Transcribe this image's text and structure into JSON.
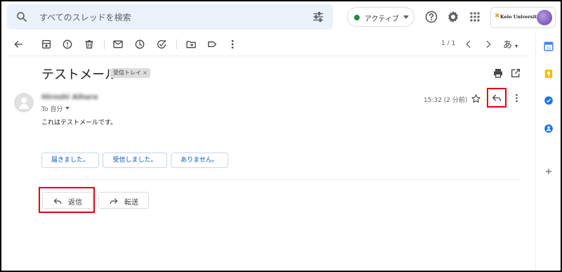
{
  "search": {
    "placeholder": "すべてのスレッドを検索"
  },
  "status": {
    "label": "アクティブ"
  },
  "org": {
    "mark": "✖",
    "name": "Keio University"
  },
  "pager": {
    "text": "1 / 1"
  },
  "input_tool": {
    "label": "あ"
  },
  "message": {
    "subject": "テストメール",
    "label_chip": "受信トレイ",
    "label_remove": "×",
    "sender": "Hiroshi Aihara",
    "to": "To 自分",
    "time": "15:32 (2 分前)",
    "body": "これはテストメールです。"
  },
  "smart_replies": [
    "届きました。",
    "受信しました。",
    "ありません。"
  ],
  "actions": {
    "reply": "返信",
    "forward": "転送"
  },
  "colors": {
    "highlight": "#e3000f",
    "search_bg": "#eaf1fb",
    "online": "#1e8e3e"
  }
}
